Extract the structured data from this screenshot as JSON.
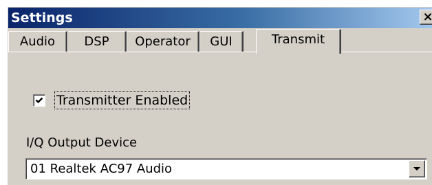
{
  "window": {
    "title": "Settings",
    "close_glyph": "×"
  },
  "tabs": [
    {
      "label": "Audio",
      "selected": false
    },
    {
      "label": "DSP",
      "selected": false
    },
    {
      "label": "Operator",
      "selected": false
    },
    {
      "label": "GUI",
      "selected": false
    },
    {
      "label": "Transmit",
      "selected": true
    }
  ],
  "transmit": {
    "transmitter_enabled": {
      "label": "Transmitter Enabled",
      "checked": true
    },
    "iq_output_device": {
      "label": "I/Q Output Device",
      "value": "01  Realtek AC97 Audio"
    }
  },
  "icons": {
    "close": "close-icon",
    "check": "checkmark-icon",
    "dropdown": "chevron-down-icon"
  },
  "colors": {
    "titlebar_start": "#0a246a",
    "titlebar_end": "#a6caf0",
    "face": "#d4d0c8"
  }
}
